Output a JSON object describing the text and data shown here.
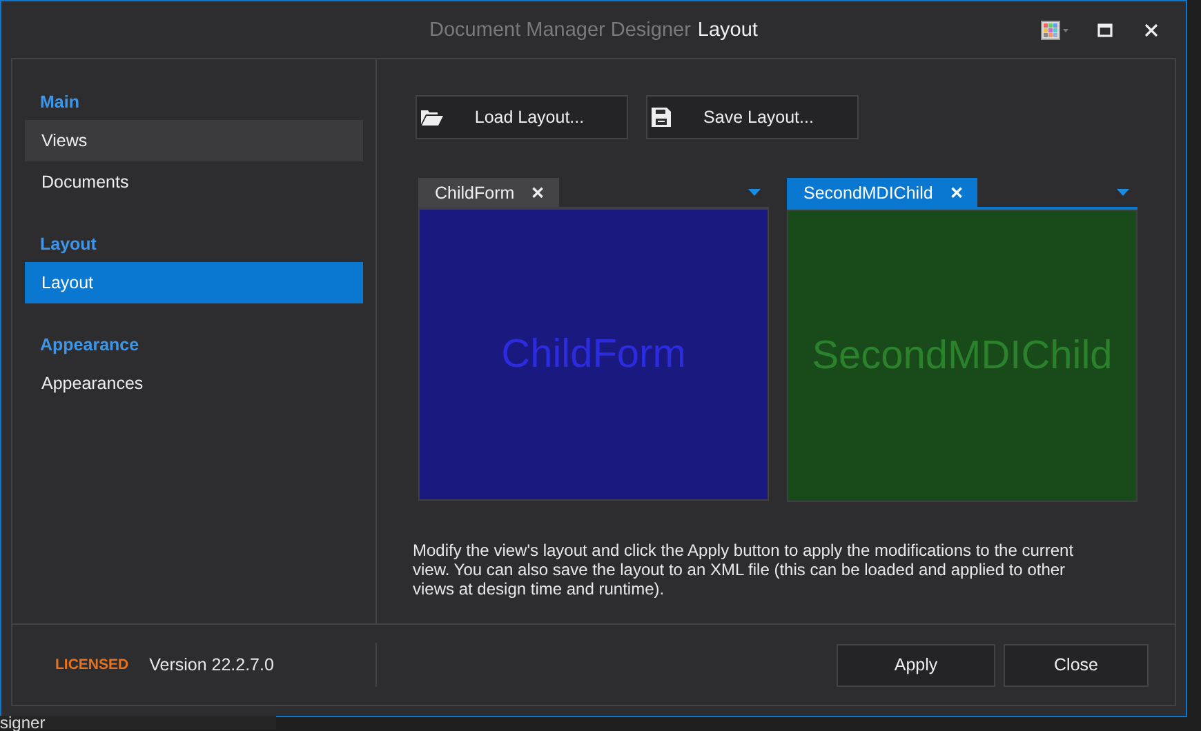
{
  "window": {
    "title_prefix": "Document Manager Designer",
    "title": "Layout"
  },
  "sidebar": {
    "groups": [
      {
        "heading": "Main",
        "items": [
          {
            "label": "Views",
            "selected": false,
            "hovered": true
          },
          {
            "label": "Documents",
            "selected": false,
            "hovered": false
          }
        ]
      },
      {
        "heading": "Layout",
        "items": [
          {
            "label": "Layout",
            "selected": true,
            "hovered": false
          }
        ]
      },
      {
        "heading": "Appearance",
        "items": [
          {
            "label": "Appearances",
            "selected": false,
            "hovered": false
          }
        ]
      }
    ]
  },
  "toolbar": [
    {
      "kind": "load",
      "label": "Load Layout..."
    },
    {
      "kind": "save",
      "label": "Save Layout..."
    }
  ],
  "documents": [
    {
      "tab": "ChildForm",
      "close": "✕",
      "selected": false,
      "content": "ChildForm",
      "color": "#19197f"
    },
    {
      "tab": "SecondMDIChild",
      "close": "✕",
      "selected": true,
      "content": "SecondMDIChild",
      "color": "#194a19"
    }
  ],
  "description": "Modify the view's layout and click the Apply button to apply the modifications to the current view. You can also save the layout to an XML file (this can be loaded and applied to other views at design time and runtime).",
  "footer": {
    "license": "LICENSED",
    "version": "Version 22.2.7.0",
    "buttons": [
      "Apply",
      "Close"
    ]
  },
  "background": {
    "fragment": "signer"
  }
}
